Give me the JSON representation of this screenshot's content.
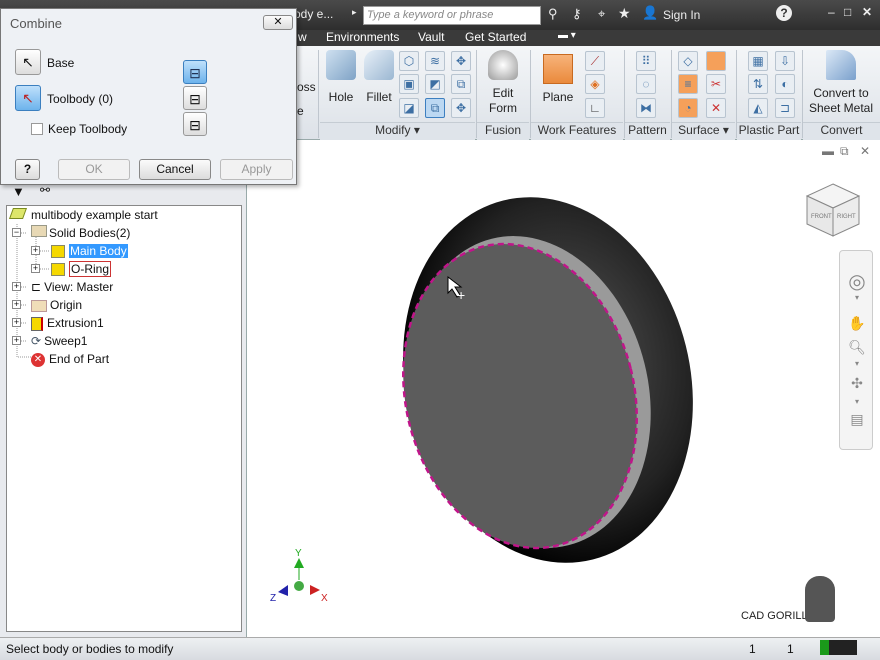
{
  "title_bar": {
    "doc_title": "ody e...",
    "search_placeholder": "Type a keyword or phrase",
    "sign_in": "Sign In"
  },
  "menu": {
    "items": [
      "w",
      "Environments",
      "Vault",
      "Get Started"
    ]
  },
  "ribbon": {
    "partial_labels": [
      "oss",
      "e"
    ],
    "buttons": {
      "hole": "Hole",
      "fillet": "Fillet",
      "edit_form_1": "Edit",
      "edit_form_2": "Form",
      "plane": "Plane",
      "convert_1": "Convert to",
      "convert_2": "Sheet Metal"
    },
    "panels": [
      "Modify ▾",
      "Fusion",
      "Work Features",
      "Pattern",
      "Surface ▾",
      "Plastic Part",
      "Convert"
    ]
  },
  "dialog": {
    "title": "Combine",
    "base": "Base",
    "toolbody": "Toolbody (0)",
    "keep_toolbody": "Keep Toolbody",
    "keep_checked": false,
    "ok": "OK",
    "cancel": "Cancel",
    "apply": "Apply"
  },
  "browser": {
    "root": "multibody example start",
    "solid_bodies": "Solid Bodies(2)",
    "main_body": "Main Body",
    "o_ring": "O-Ring",
    "view": "View: Master",
    "origin": "Origin",
    "extrusion": "Extrusion1",
    "sweep": "Sweep1",
    "end": "End of Part"
  },
  "viewport": {
    "viewcube_front": "FRONT",
    "viewcube_right": "RIGHT",
    "axis_x": "X",
    "axis_y": "Y",
    "axis_z": "Z",
    "watermark": "CAD GORILLA"
  },
  "status": {
    "message": "Select body or bodies to modify",
    "count1": "1",
    "count2": "1"
  },
  "colors": {
    "selection": "#c0158a",
    "highlight": "#3399ff"
  }
}
